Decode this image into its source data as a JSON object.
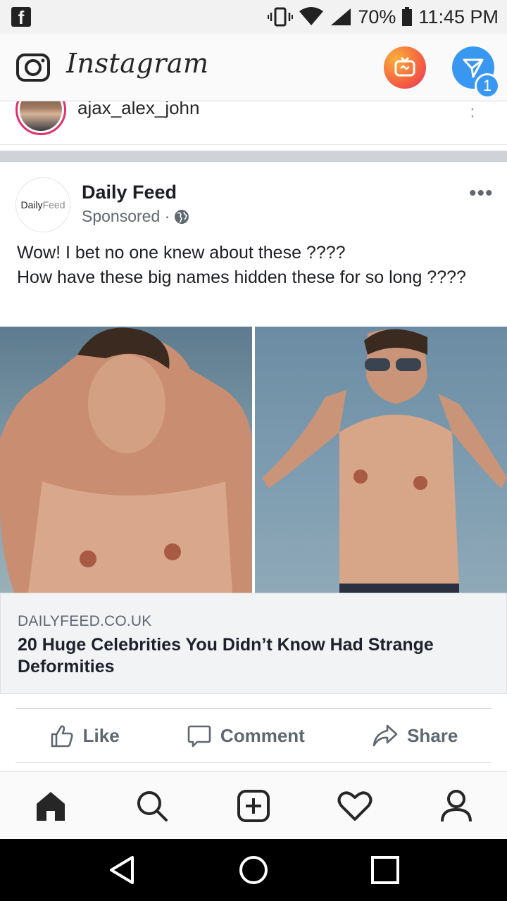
{
  "status_bar": {
    "battery": "70%",
    "time": "11:45 PM"
  },
  "header": {
    "logo": "Instagram",
    "direct_badge": "1"
  },
  "story_user": {
    "username": "ajax_alex_john"
  },
  "ad": {
    "avatar_text_1": "Daily",
    "avatar_text_2": "Feed",
    "page_name": "Daily Feed",
    "sponsored": "Sponsored ·",
    "text_line_1": "Wow! I bet no one knew about these ????",
    "text_line_2": "How have these big names hidden these for so long ????",
    "link_domain": "DAILYFEED.CO.UK",
    "link_title": "20 Huge Celebrities You Didn’t Know Had Strange Deformities",
    "actions": {
      "like": "Like",
      "comment": "Comment",
      "share": "Share"
    }
  },
  "bottom_nav": {
    "items": [
      "home",
      "search",
      "new-post",
      "activity",
      "profile"
    ]
  },
  "colors": {
    "accent_blue": "#3897f0",
    "fb_grey_text": "#606770",
    "separator": "#cfd3d7"
  }
}
